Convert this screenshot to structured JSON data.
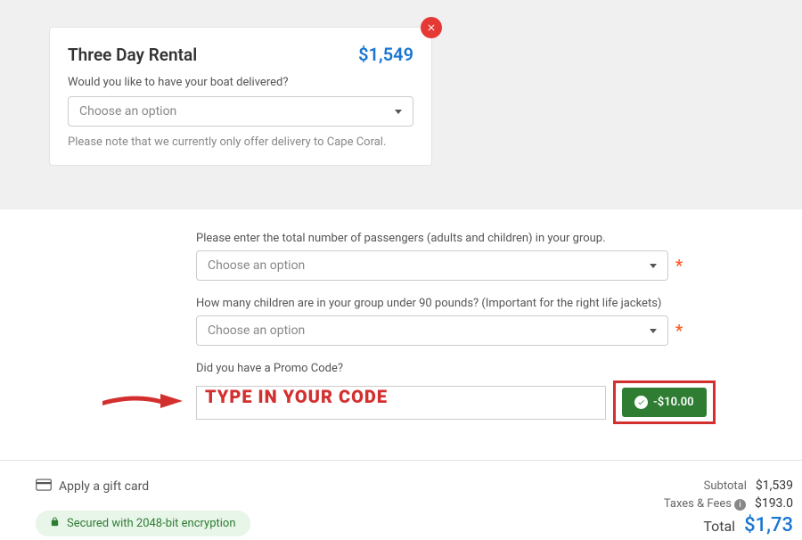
{
  "card": {
    "title": "Three Day Rental",
    "price": "$1,549",
    "deliveryLabel": "Would you like to have your boat delivered?",
    "selectPlaceholder": "Choose an option",
    "note": "Please note that we currently only offer delivery to Cape Coral."
  },
  "fields": {
    "passengersLabel": "Please enter the total number of passengers (adults and children) in your group.",
    "childrenLabel": "How many children are in your group under 90 pounds? (Important for the right life jackets)",
    "promoLabel": "Did you have a Promo Code?",
    "selectPlaceholder": "Choose an option",
    "promoPlaceholder": "",
    "promoOverlay": "TYPE IN YOUR CODE",
    "promoApplied": "-$10.00"
  },
  "footer": {
    "giftLabel": "Apply a gift card",
    "secureLabel": "Secured with 2048-bit encryption",
    "subtotalLabel": "Subtotal",
    "subtotalValue": "$1,539",
    "taxesLabel": "Taxes & Fees",
    "taxesValue": "$193.0",
    "totalLabel": "Total",
    "totalValue": "$1,73"
  }
}
